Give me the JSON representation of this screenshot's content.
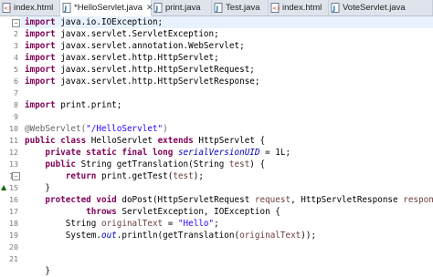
{
  "tabs": [
    {
      "label": "index.html",
      "icon": "html-file-icon",
      "active": false
    },
    {
      "label": "*HelloServlet.java",
      "icon": "java-file-icon",
      "active": true
    },
    {
      "label": "print.java",
      "icon": "java-file-icon",
      "active": false
    },
    {
      "label": "Test.java",
      "icon": "java-file-icon",
      "active": false
    },
    {
      "label": "index.html",
      "icon": "html-file-icon",
      "active": false
    },
    {
      "label": "VoteServlet.java",
      "icon": "java-file-icon",
      "active": false
    }
  ],
  "close_glyph": "✕",
  "line_numbers": [
    "",
    "2",
    "3",
    "4",
    "5",
    "6",
    "7",
    "8",
    "9",
    "10",
    "11",
    "12",
    "13",
    "14",
    "15",
    "16",
    "17",
    "18",
    "19",
    "20",
    "21",
    "22",
    "23"
  ],
  "code": {
    "l1": {
      "kw": "import",
      "rest": " java.io.IOException;"
    },
    "l2": {
      "kw": "import",
      "rest": " javax.servlet.ServletException;"
    },
    "l3": {
      "kw": "import",
      "rest": " javax.servlet.annotation.WebServlet;"
    },
    "l4": {
      "kw": "import",
      "rest": " javax.servlet.http.HttpServlet;"
    },
    "l5": {
      "kw": "import",
      "rest": " javax.servlet.http.HttpServletRequest;"
    },
    "l6": {
      "kw": "import",
      "rest": " javax.servlet.http.HttpServletResponse;"
    },
    "l8": {
      "kw": "import",
      "rest": " print.print;"
    },
    "l10": {
      "ann": "@WebServlet(",
      "str": "\"/HelloServlet\"",
      "end": ")"
    },
    "l11": {
      "kw1": "public",
      "kw2": "class",
      "name": " HelloServlet ",
      "kw3": "extends",
      "rest": " HttpServlet {"
    },
    "l12": {
      "kw": "private static final long",
      "field": "serialVersionUID",
      "rest": " = 1L;"
    },
    "l13": {
      "kw": "public",
      "rest1": " String getTranslation(String ",
      "var": "test",
      "rest2": ") {"
    },
    "l14": {
      "kw": "return",
      "rest1": " print.getTest(",
      "var": "test",
      "rest2": ");"
    },
    "l15": {
      "rest": "}"
    },
    "l16": {
      "kw1": "protected",
      "kw2": "void",
      "rest1": " doPost(HttpServletRequest ",
      "var1": "request",
      "rest2": ", HttpServletResponse ",
      "var2": "response",
      "rest3": ")"
    },
    "l17": {
      "kw": "throws",
      "rest": " ServletException, IOException {"
    },
    "l18": {
      "rest1": "String ",
      "var": "originalText",
      "rest2": " = ",
      "str": "\"Hello\"",
      "rest3": ";"
    },
    "l19": {
      "rest1": "System.",
      "sfx": "out",
      "rest2": ".println(getTranslation(",
      "var": "originalText",
      "rest3": "));"
    },
    "l22": {
      "rest": "}"
    }
  }
}
